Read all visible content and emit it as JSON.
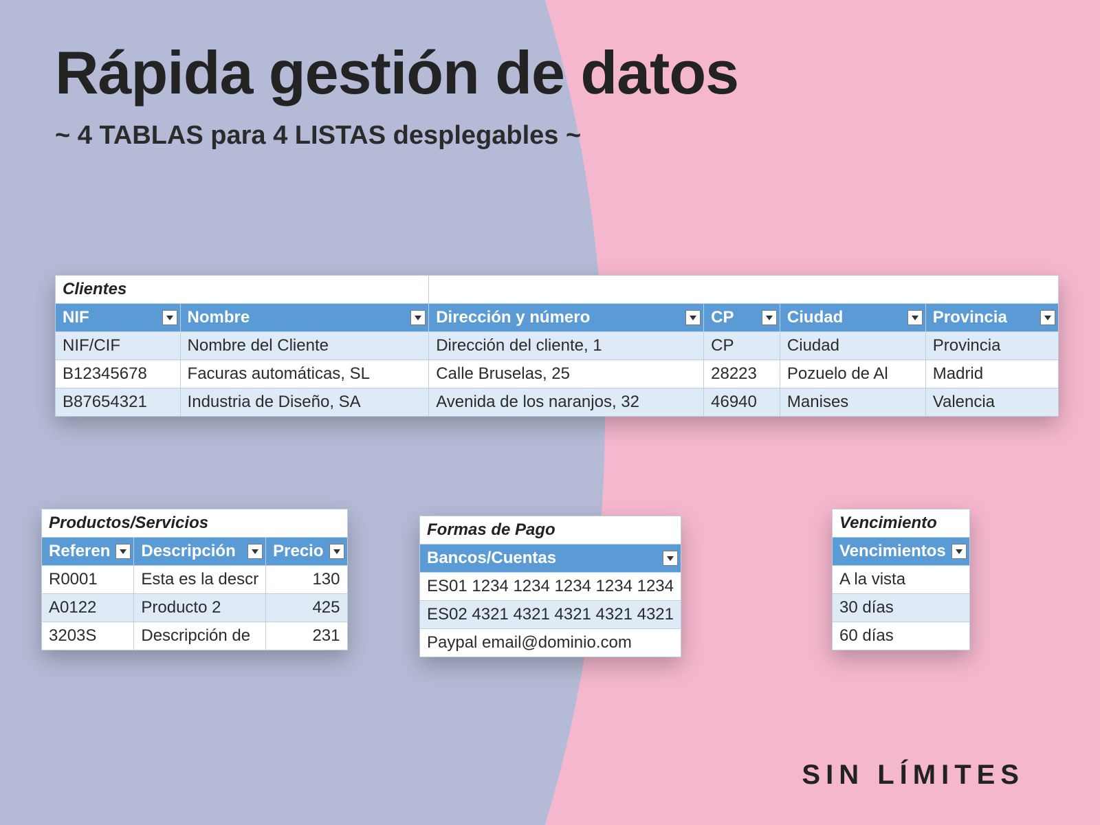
{
  "title": "Rápida gestión de datos",
  "subtitle_prefix": "~ ",
  "subtitle_a": "4 TABLAS",
  "subtitle_mid": " para ",
  "subtitle_b": "4 LISTAS",
  "subtitle_end": " desplegables ~",
  "footer": "SIN LÍMITES",
  "clientes": {
    "title": "Clientes",
    "headers": [
      "NIF",
      "Nombre",
      "Dirección y número",
      "CP",
      "Ciudad",
      "Provincia"
    ],
    "rows": [
      [
        "NIF/CIF",
        "Nombre del Cliente",
        "Dirección del cliente, 1",
        "CP",
        "Ciudad",
        "Provincia"
      ],
      [
        "B12345678",
        "Facuras automáticas, SL",
        "Calle Bruselas, 25",
        "28223",
        "Pozuelo de Al",
        "Madrid"
      ],
      [
        "B87654321",
        "Industria de Diseño, SA",
        "Avenida de los naranjos, 32",
        "46940",
        "Manises",
        "Valencia"
      ]
    ]
  },
  "productos": {
    "title": "Productos/Servicios",
    "headers": [
      "Referen",
      "Descripción",
      "Precio"
    ],
    "rows": [
      [
        "R0001",
        "Esta es la descr",
        "130"
      ],
      [
        "A0122",
        "Producto 2",
        "425"
      ],
      [
        "3203S",
        "Descripción de",
        "231"
      ]
    ]
  },
  "pagos": {
    "title": "Formas de Pago",
    "headers": [
      "Bancos/Cuentas"
    ],
    "rows": [
      [
        "ES01 1234 1234 1234 1234 1234"
      ],
      [
        "ES02 4321 4321 4321 4321 4321"
      ],
      [
        "Paypal email@dominio.com"
      ]
    ]
  },
  "venc": {
    "title": "Vencimiento",
    "headers": [
      "Vencimientos"
    ],
    "rows": [
      [
        "A la vista"
      ],
      [
        "30 días"
      ],
      [
        "60 días"
      ]
    ]
  }
}
